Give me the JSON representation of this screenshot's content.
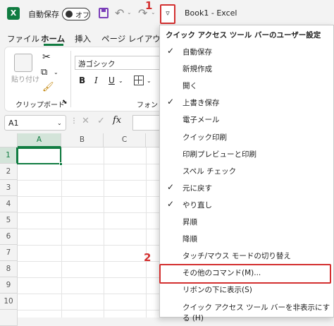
{
  "titlebar": {
    "app_icon": "excel-logo",
    "app_icon_letter": "X",
    "autosave_label": "自動保存",
    "autosave_state": "オフ",
    "doc_title": "Book1  -  Excel",
    "step1_marker": "1",
    "qat_customize_glyph": "▿"
  },
  "tabs": [
    {
      "label": "ファイル"
    },
    {
      "label": "ホーム"
    },
    {
      "label": "挿入"
    },
    {
      "label": "ページ レイアウト"
    }
  ],
  "ribbon": {
    "paste_label": "貼り付け",
    "clipboard_label": "クリップボード",
    "font_name": "游ゴシック",
    "bold": "B",
    "italic": "I",
    "underline": "U",
    "font_label": "フォント"
  },
  "formula_bar": {
    "namebox_value": "A1",
    "fx_label": "fx"
  },
  "grid": {
    "columns": [
      "A",
      "B",
      "C"
    ],
    "rows": [
      "1",
      "2",
      "3",
      "4",
      "5",
      "6",
      "7",
      "8",
      "9",
      "10"
    ],
    "active_cell": "A1"
  },
  "menu": {
    "header": "クイック アクセス ツール バーのユーザー設定",
    "items": [
      {
        "label": "自動保存",
        "checked": true
      },
      {
        "label": "新規作成",
        "checked": false
      },
      {
        "label": "開く",
        "checked": false
      },
      {
        "label": "上書き保存",
        "checked": true
      },
      {
        "label": "電子メール",
        "checked": false
      },
      {
        "label": "クイック印刷",
        "checked": false
      },
      {
        "label": "印刷プレビューと印刷",
        "checked": false
      },
      {
        "label": "スペル チェック",
        "checked": false
      },
      {
        "label": "元に戻す",
        "checked": true
      },
      {
        "label": "やり直し",
        "checked": true
      },
      {
        "label": "昇順",
        "checked": false
      },
      {
        "label": "降順",
        "checked": false
      },
      {
        "label": "タッチ/マウス モードの切り替え",
        "checked": false
      },
      {
        "label": "その他のコマンド(M)...",
        "checked": false
      },
      {
        "label": "リボンの下に表示(S)",
        "checked": false
      },
      {
        "label": "クイック アクセス ツール バーを非表示にする (H)",
        "checked": false
      }
    ],
    "step2_marker": "2"
  },
  "colors": {
    "excel_green": "#107c41",
    "highlight_red": "#d32f2f"
  }
}
